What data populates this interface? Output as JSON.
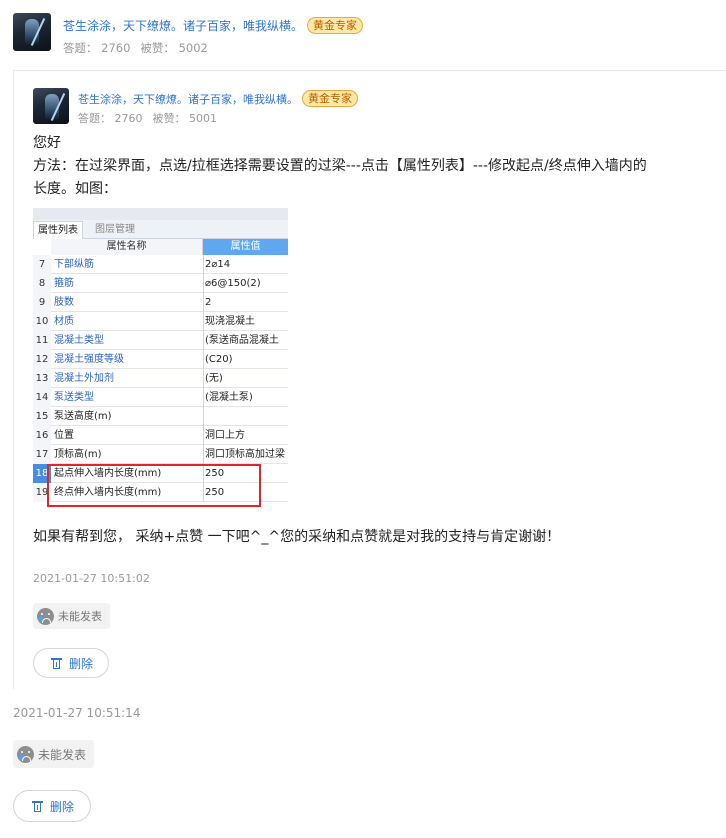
{
  "outer_answer": {
    "user": {
      "name": "苍生涂涂，天下缭燎。诸子百家，唯我纵横。",
      "badge": "黄金专家",
      "answers_label": "答题： 2760",
      "likes_label": "被赞： 5002"
    },
    "timestamp": "2021-01-27 10:51:14",
    "status_chip": "未能发表",
    "delete_label": "删除"
  },
  "inner_answer": {
    "user": {
      "name": "苍生涂涂，天下缭燎。诸子百家，唯我纵横。",
      "badge": "黄金专家",
      "answers_label": "答题： 2760",
      "likes_label": "被赞： 5001"
    },
    "greeting": "您好",
    "method_line1": "方法：在过梁界面，点选/拉框选择需要设置的过梁---点击【属性列表】---修改起点/终点伸入墙内的",
    "method_line2": "长度。如图：",
    "closing": "如果有帮到您， 采纳+点赞 一下吧^_^您的采纳和点赞就是对我的支持与肯定谢谢！",
    "timestamp": "2021-01-27 10:51:02",
    "status_chip": "未能发表",
    "delete_label": "删除"
  },
  "property_panel": {
    "tab_active": "属性列表",
    "tab_inactive": "图层管理",
    "col_name": "属性名称",
    "col_value": "属性值",
    "rows": [
      {
        "num": "7",
        "name": "下部纵筋",
        "value": "2⌀14",
        "blue": true
      },
      {
        "num": "8",
        "name": "箍筋",
        "value": "⌀6@150(2)",
        "blue": true
      },
      {
        "num": "9",
        "name": "肢数",
        "value": "2",
        "blue": true
      },
      {
        "num": "10",
        "name": "材质",
        "value": "现浇混凝土",
        "blue": true
      },
      {
        "num": "11",
        "name": "混凝土类型",
        "value": "(泵送商品混凝土",
        "blue": true
      },
      {
        "num": "12",
        "name": "混凝土强度等级",
        "value": "(C20)",
        "blue": true
      },
      {
        "num": "13",
        "name": "混凝土外加剂",
        "value": "(无)",
        "blue": true
      },
      {
        "num": "14",
        "name": "泵送类型",
        "value": "(混凝土泵)",
        "blue": true
      },
      {
        "num": "15",
        "name": "泵送高度(m)",
        "value": "",
        "blue": false
      },
      {
        "num": "16",
        "name": "位置",
        "value": "洞口上方",
        "blue": false
      },
      {
        "num": "17",
        "name": "顶标高(m)",
        "value": "洞口顶标高加过梁",
        "blue": false
      },
      {
        "num": "18",
        "name": "起点伸入墙内长度(mm)",
        "value": "250",
        "blue": false
      },
      {
        "num": "19",
        "name": "终点伸入墙内长度(mm)",
        "value": "250",
        "blue": false
      }
    ]
  }
}
